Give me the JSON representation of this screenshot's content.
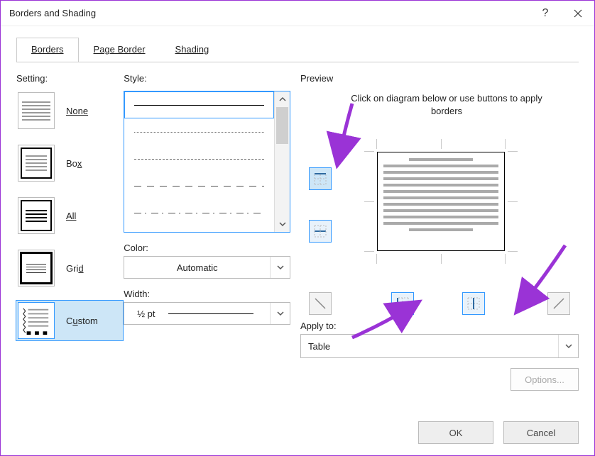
{
  "window": {
    "title": "Borders and Shading"
  },
  "tabs": {
    "borders": "Borders",
    "page_border": "Page Border",
    "shading": "Shading"
  },
  "setting": {
    "label": "Setting:",
    "none": "None",
    "box": "Box",
    "all": "All",
    "grid": "Grid",
    "custom": "Custom"
  },
  "style": {
    "label": "Style:",
    "color_label": "Color:",
    "color_value": "Automatic",
    "width_label": "Width:",
    "width_value": "½ pt"
  },
  "preview": {
    "label": "Preview",
    "hint": "Click on diagram below or use buttons to apply borders",
    "apply_label": "Apply to:",
    "apply_value": "Table",
    "options": "Options..."
  },
  "footer": {
    "ok": "OK",
    "cancel": "Cancel"
  }
}
